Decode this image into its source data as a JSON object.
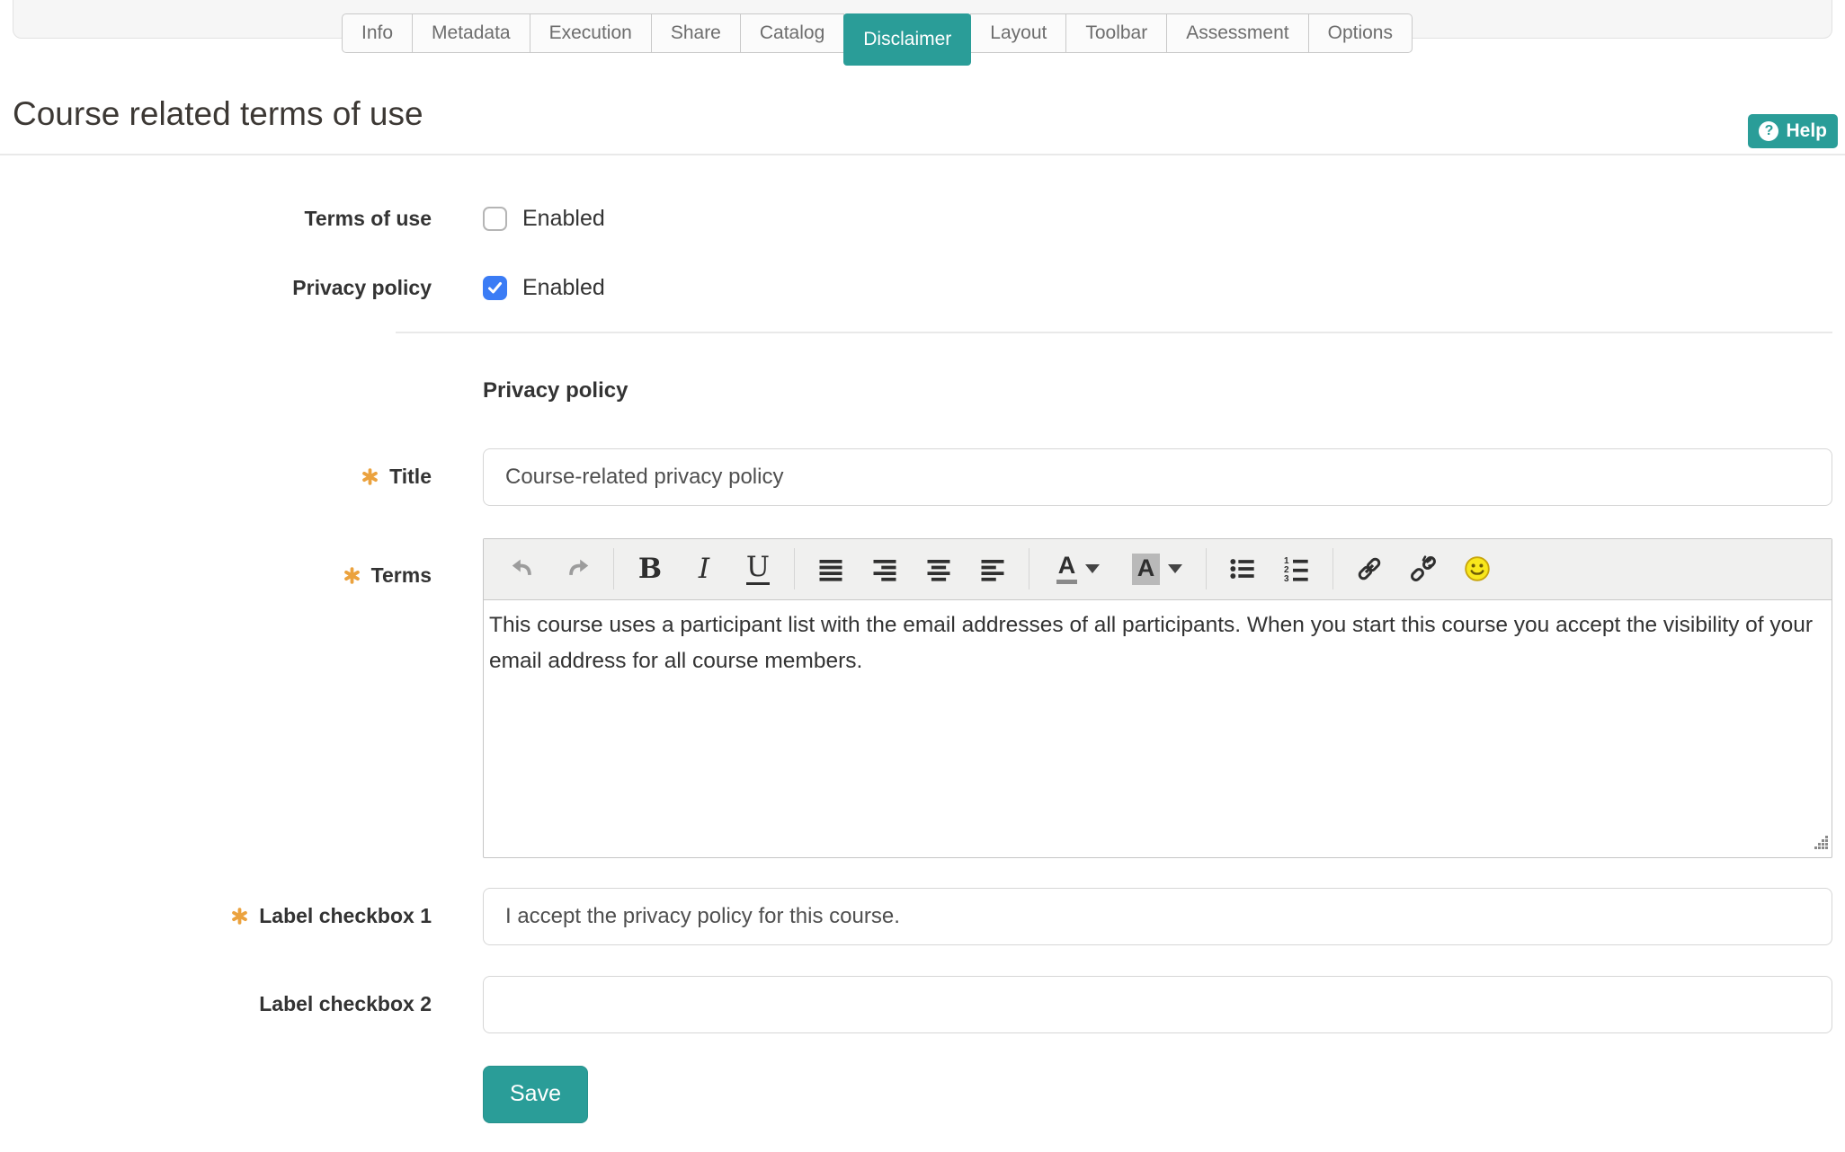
{
  "tabs": {
    "items": [
      {
        "label": "Info",
        "active": "no"
      },
      {
        "label": "Metadata",
        "active": "no"
      },
      {
        "label": "Execution",
        "active": "no"
      },
      {
        "label": "Share",
        "active": "no"
      },
      {
        "label": "Catalog",
        "active": "no"
      },
      {
        "label": "Disclaimer",
        "active": "yes"
      },
      {
        "label": "Layout",
        "active": "no"
      },
      {
        "label": "Toolbar",
        "active": "no"
      },
      {
        "label": "Assessment",
        "active": "no"
      },
      {
        "label": "Options",
        "active": "no"
      }
    ]
  },
  "header": {
    "title": "Course related terms of use",
    "help": {
      "icon": "?",
      "label": "Help"
    }
  },
  "form": {
    "terms_of_use": {
      "label": "Terms of use",
      "checkbox_label": "Enabled",
      "checked": "no"
    },
    "privacy_policy": {
      "label": "Privacy policy",
      "checkbox_label": "Enabled",
      "checked": "yes"
    },
    "section_heading": "Privacy policy",
    "title_field": {
      "label": "Title",
      "required": "yes",
      "value": "Course-related privacy policy"
    },
    "terms_field": {
      "label": "Terms",
      "required": "yes",
      "value": "This course uses a participant list with the email addresses of all participants. When you start this course you accept the visibility of your email address for all course members."
    },
    "label_checkbox_1": {
      "label": "Label checkbox 1",
      "required": "yes",
      "value": "I accept the privacy policy for this course."
    },
    "label_checkbox_2": {
      "label": "Label checkbox 2",
      "required": "no",
      "value": ""
    },
    "save_label": "Save"
  },
  "editor": {
    "glyphs": {
      "bold": "B",
      "italic": "I",
      "underline": "U",
      "text_color": "A",
      "highlight_color": "A"
    },
    "toolbar_icons": [
      "undo-icon",
      "redo-icon",
      "bold-icon",
      "italic-icon",
      "underline-icon",
      "align-justify-icon",
      "align-right-icon",
      "align-center-icon",
      "align-left-icon",
      "text-color-icon",
      "highlight-color-icon",
      "bullet-list-icon",
      "numbered-list-icon",
      "link-icon",
      "unlink-icon",
      "smiley-icon",
      "resize-grip-icon"
    ]
  },
  "colors": {
    "accent_teal": "#2a9d98",
    "checkbox_blue": "#3b7cf5",
    "required_orange": "#eba23e",
    "tab_text_gray": "#6d6d6d"
  }
}
